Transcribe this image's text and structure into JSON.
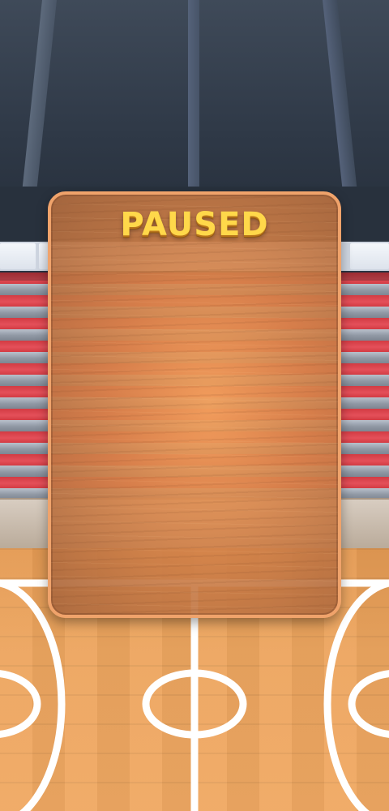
{
  "pause_panel": {
    "title": "PAUSED"
  },
  "colors": {
    "title_fill": "#ffd84a",
    "panel_border": "#f0a36b",
    "bleacher_red": "#d33b43",
    "court_wood": "#eda660",
    "court_lines": "#ffffff"
  }
}
